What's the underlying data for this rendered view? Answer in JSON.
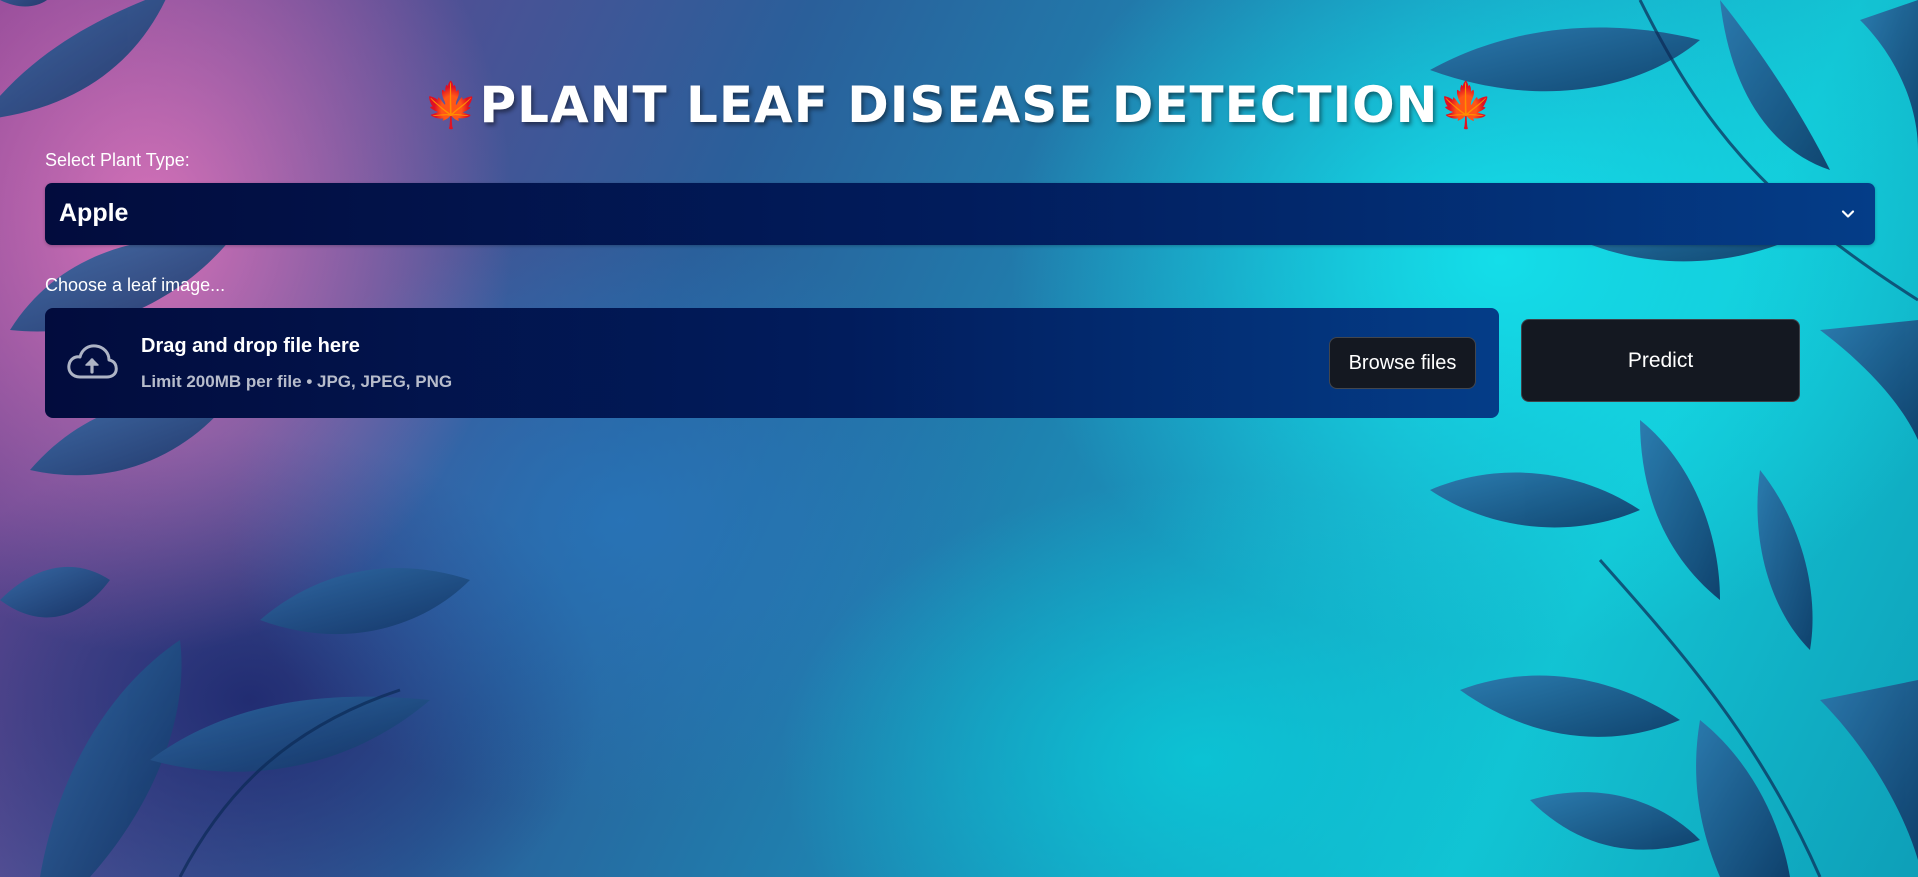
{
  "header": {
    "title": "PLANT LEAF DISEASE DETECTION",
    "icon": "maple-leaf-icon",
    "icon_glyph": "🍁"
  },
  "plant_select": {
    "label": "Select Plant Type:",
    "selected_value": "Apple",
    "icon": "chevron-down-icon"
  },
  "file_uploader": {
    "label": "Choose a leaf image...",
    "icon": "cloud-upload-icon",
    "drop_title": "Drag and drop file here",
    "drop_hint": "Limit 200MB per file • JPG, JPEG, PNG",
    "browse_label": "Browse files"
  },
  "actions": {
    "predict_label": "Predict"
  },
  "colors": {
    "panel_start": "#020c3d",
    "panel_end": "#043d88",
    "button_bg": "#141821",
    "title_icon": "#e8232f"
  }
}
